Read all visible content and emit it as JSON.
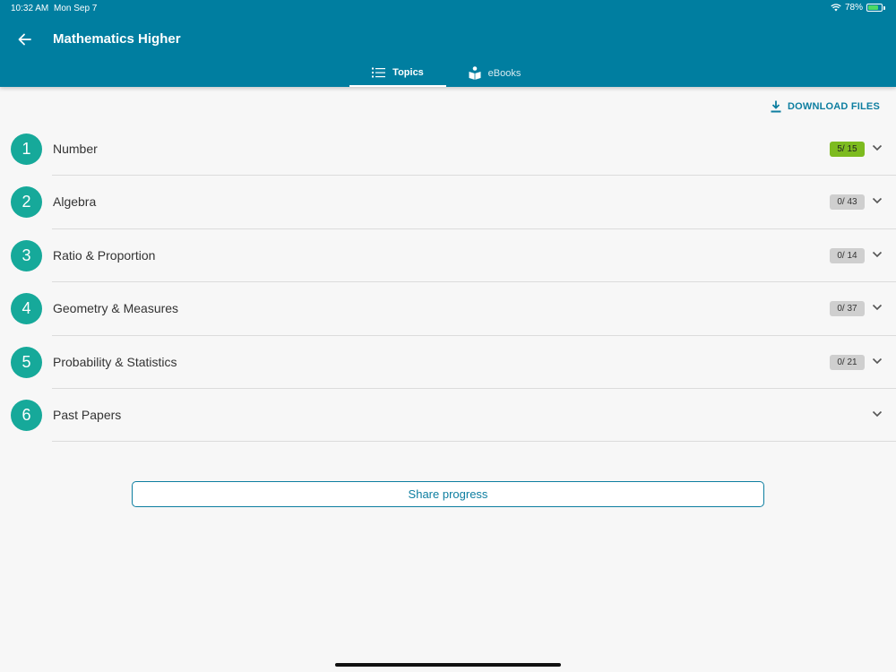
{
  "status_bar": {
    "time": "10:32 AM",
    "date": "Mon Sep 7",
    "battery": "78%",
    "battery_level": 0.78,
    "icons": [
      "wifi-icon",
      "battery-icon"
    ]
  },
  "header": {
    "title": "Mathematics Higher",
    "back_icon": "arrow-left-icon",
    "color": "#007ea0"
  },
  "tabs": [
    {
      "label": "Topics",
      "icon": "list-icon",
      "active": true
    },
    {
      "label": "eBooks",
      "icon": "book-icon",
      "active": false
    }
  ],
  "download": {
    "label": "DOWNLOAD FILES",
    "icon": "download-icon"
  },
  "topics": [
    {
      "number": "1",
      "title": "Number",
      "progress": "5/ 15",
      "complete": true
    },
    {
      "number": "2",
      "title": "Algebra",
      "progress": "0/ 43",
      "complete": false
    },
    {
      "number": "3",
      "title": "Ratio & Proportion",
      "progress": "0/ 14",
      "complete": false
    },
    {
      "number": "4",
      "title": "Geometry & Measures",
      "progress": "0/ 37",
      "complete": false
    },
    {
      "number": "5",
      "title": "Probability & Statistics",
      "progress": "0/ 21",
      "complete": false
    },
    {
      "number": "6",
      "title": "Past Papers",
      "progress": null,
      "complete": false
    }
  ],
  "share_button": {
    "label": "Share progress"
  },
  "colors": {
    "accent": "#007ea0",
    "circle": "#16a99a",
    "progress_done": "#7dbb1f",
    "progress_empty": "#cfcfcf"
  }
}
